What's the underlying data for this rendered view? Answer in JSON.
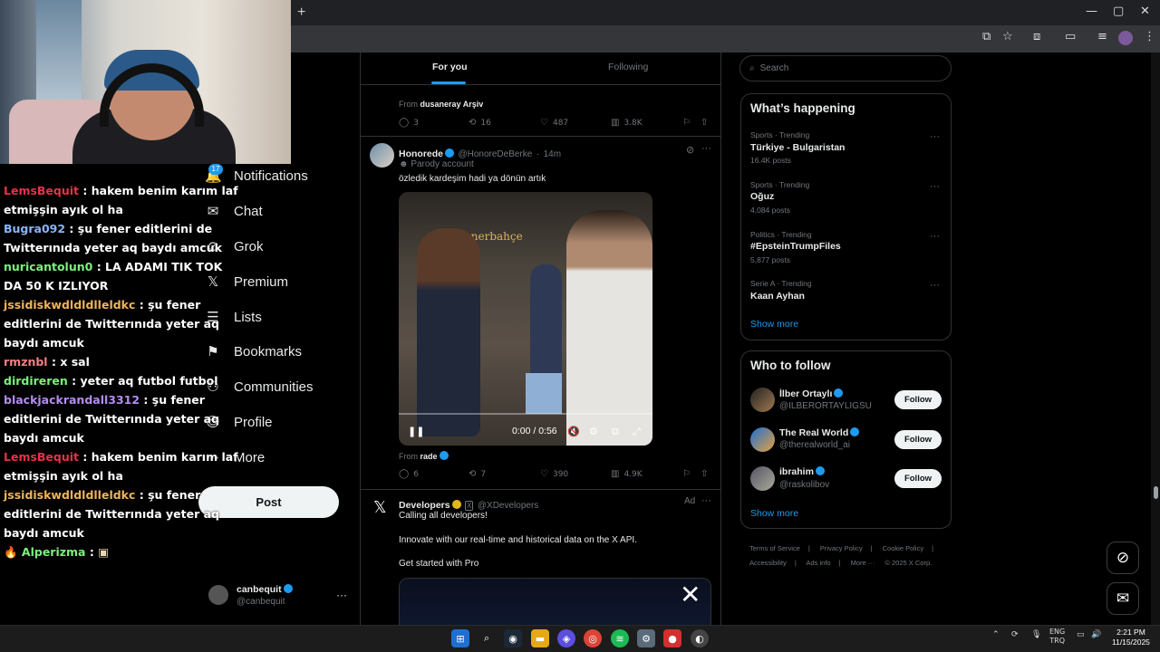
{
  "browser": {
    "new_tab": "+",
    "minimize": "—",
    "maximize": "▢",
    "close": "✕"
  },
  "chat": [
    {
      "user": "LemsBequit",
      "color": "#e8324a",
      "text": "hakem benim karım laf etmişşin ayık ol ha"
    },
    {
      "user": "Bugra092",
      "color": "#8ab4f8",
      "text": "şu fener editlerini de Twitterınıda yeter aq baydı amcuk"
    },
    {
      "user": "nuricantolun0",
      "color": "#7cf27c",
      "text": "LA ADAMI TIK TOK DA 50 K IZLIYOR"
    },
    {
      "user": "jssidiskwdldldlleldkc",
      "color": "#f0b35a",
      "text": "şu fener editlerini de Twitterınıda yeter aq baydı amcuk"
    },
    {
      "user": "rmznbl",
      "color": "#f08080",
      "text": "x sal"
    },
    {
      "user": "dirdireren",
      "color": "#7cf27c",
      "text": "yeter aq futbol futbol"
    },
    {
      "user": "blackjackrandall3312",
      "color": "#b48cf0",
      "text": "şu fener editlerini de Twitterınıda yeter aq baydı amcuk"
    },
    {
      "user": "LemsBequit",
      "color": "#e8324a",
      "text": "hakem benim karım laf etmişşin ayık ol ha"
    },
    {
      "user": "jssidiskwdldldlleldkc",
      "color": "#f0b35a",
      "text": "şu fener editlerini de Twitterınıda yeter aq baydı amcuk"
    },
    {
      "user": "Alperizma",
      "color": "#7cf27c",
      "text": ""
    }
  ],
  "nav": {
    "notif_count": "17",
    "items": [
      {
        "label": "Notifications",
        "icon": "🔔"
      },
      {
        "label": "Chat",
        "icon": "✉"
      },
      {
        "label": "Grok",
        "icon": "⊘"
      },
      {
        "label": "Premium",
        "icon": "𝕏"
      },
      {
        "label": "Lists",
        "icon": "☰"
      },
      {
        "label": "Bookmarks",
        "icon": "⚑"
      },
      {
        "label": "Communities",
        "icon": "⚇"
      },
      {
        "label": "Profile",
        "icon": "☺"
      },
      {
        "label": "More",
        "icon": "⋯"
      }
    ],
    "post_label": "Post",
    "account_name": "canbequit",
    "account_handle": "@canbequit",
    "account_more": "···"
  },
  "feed": {
    "tabs": [
      "For you",
      "Following"
    ],
    "prev_tweet": {
      "from_label": "From",
      "from_source": "dusaneray Arşiv",
      "replies": "3",
      "reposts": "16",
      "likes": "487",
      "views": "3.8K"
    },
    "tweet": {
      "name": "Honorede",
      "handle": "@HonoreDeBerke",
      "time": "14m",
      "sep": "·",
      "label": "Parody account",
      "text": "özledik kardeşim hadi ya dönün artık",
      "video_sign": "Fenerbahçe",
      "video_time": "0:00 / 0:56",
      "video_progress": 0,
      "from_label": "From",
      "from_source": "rade",
      "replies": "6",
      "reposts": "7",
      "likes": "390",
      "views": "4.9K"
    },
    "ad": {
      "name": "Developers",
      "handle": "@XDevelopers",
      "badge": "Ad",
      "line1": "Calling all developers!",
      "line2": "Innovate with our real-time and historical data on the X API.",
      "line3": "Get started with Pro"
    }
  },
  "sidebar": {
    "search_placeholder": "Search",
    "happening_title": "What’s happening",
    "trends": [
      {
        "category": "Sports · Trending",
        "title": "Türkiye - Bulgaristan",
        "count": "16.4K posts"
      },
      {
        "category": "Sports · Trending",
        "title": "Oğuz",
        "count": "4,084 posts"
      },
      {
        "category": "Politics · Trending",
        "title": "#EpsteinTrumpFiles",
        "count": "5,877 posts"
      },
      {
        "category": "Serie A · Trending",
        "title": "Kaan Ayhan",
        "count": ""
      }
    ],
    "show_more": "Show more",
    "wtf_title": "Who to follow",
    "follow": [
      {
        "name": "İlber Ortaylı",
        "handle": "@ILBERORTAYLIGSU",
        "button": "Follow"
      },
      {
        "name": "The Real World",
        "handle": "@therealworld_ai",
        "button": "Follow"
      },
      {
        "name": "ibrahim",
        "handle": "@raskolibov",
        "button": "Follow"
      }
    ],
    "footer": [
      "Terms of Service",
      "|",
      "Privacy Policy",
      "|",
      "Cookie Policy",
      "|",
      "Accessibility",
      "|",
      "Ads info",
      "|",
      "More ···",
      "© 2025 X Corp."
    ]
  },
  "taskbar": {
    "lang1": "ENG",
    "lang2": "TRQ",
    "time": "2:21 PM",
    "date": "11/15/2025"
  },
  "colors": {
    "accent": "#1d9bf0",
    "verified_gold": "#e2b719"
  }
}
